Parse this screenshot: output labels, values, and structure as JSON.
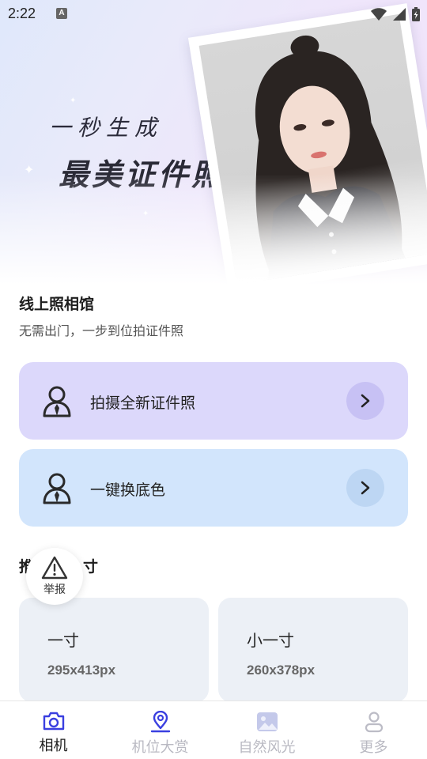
{
  "status_bar": {
    "time": "2:22",
    "notif_letter": "A"
  },
  "hero": {
    "line1": "一秒生成",
    "line2": "最美证件照"
  },
  "section": {
    "title": "线上照相馆",
    "subtitle": "无需出门，一步到位拍证件照"
  },
  "actions": [
    {
      "label": "拍摄全新证件照",
      "color": "#dcd8fb"
    },
    {
      "label": "一键换底色",
      "color": "#d2e5fc"
    }
  ],
  "section2": {
    "title_visible": "推",
    "title_visible_end": "寸"
  },
  "report": {
    "label": "举报"
  },
  "sizes": [
    {
      "name": "一寸",
      "dims": "295x413px"
    },
    {
      "name": "小一寸",
      "dims": "260x378px"
    }
  ],
  "nav": [
    {
      "label": "相机",
      "icon": "camera-icon",
      "active": true
    },
    {
      "label": "机位大赏",
      "icon": "location-pin-icon",
      "active": false
    },
    {
      "label": "自然风光",
      "icon": "image-icon",
      "active": false
    },
    {
      "label": "更多",
      "icon": "person-icon",
      "active": false
    }
  ],
  "colors": {
    "accent": "#3a3fe0",
    "inactive": "#b9b9c2"
  }
}
